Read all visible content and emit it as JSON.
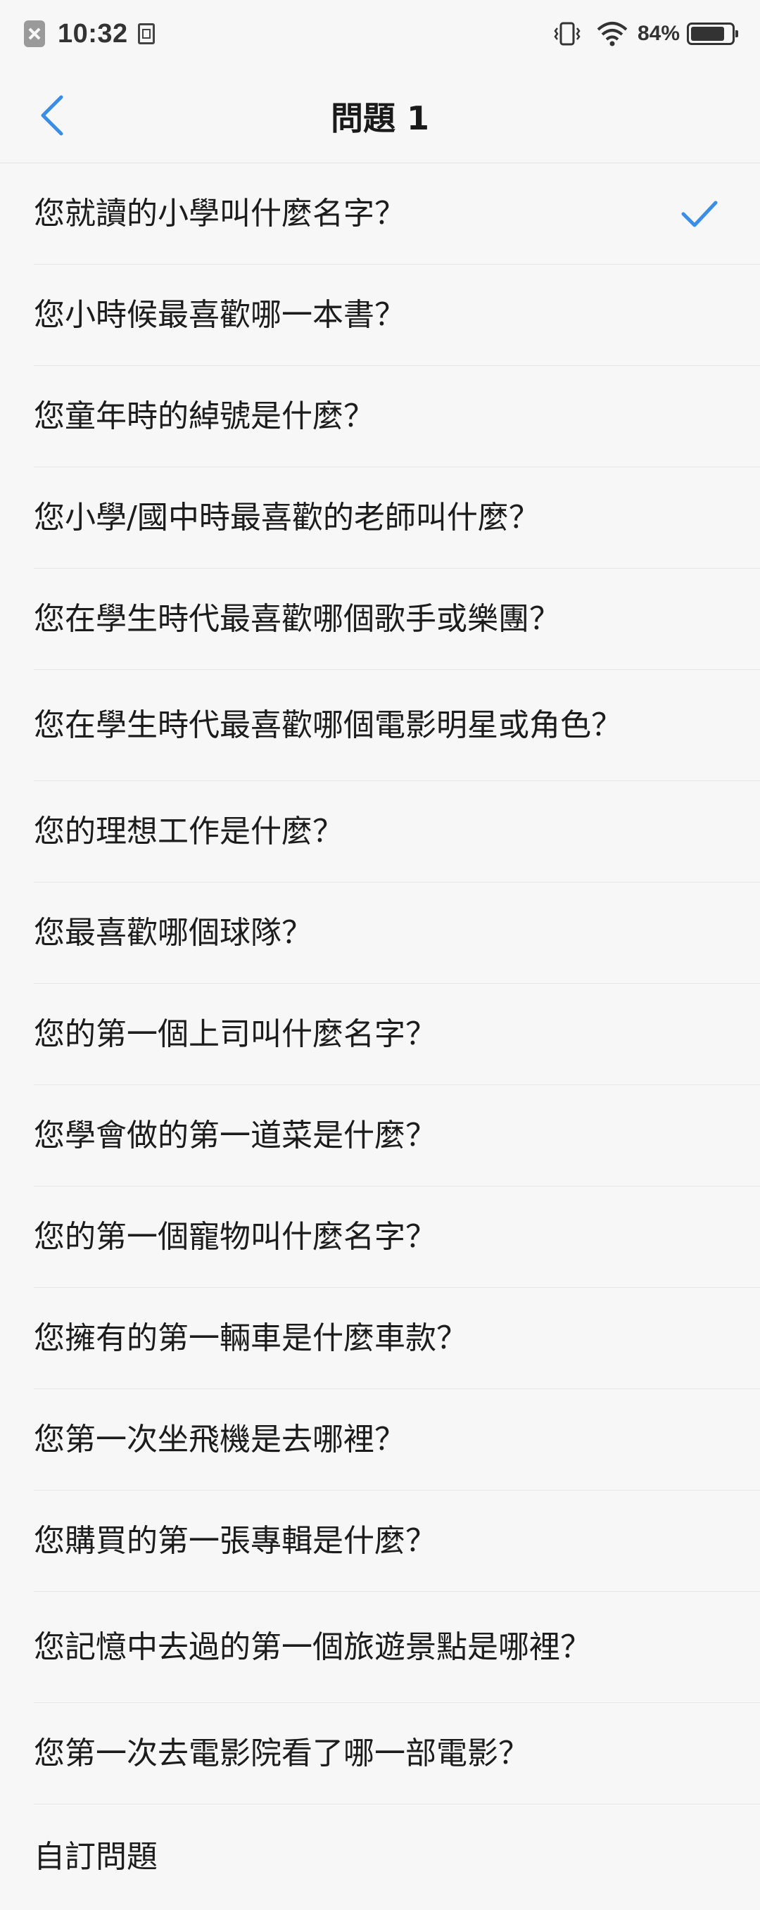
{
  "status_bar": {
    "time": "10:32",
    "battery_percent": "84%",
    "battery_level": 0.84,
    "icons": [
      "notification-icon",
      "sim-icon",
      "vibrate-icon",
      "wifi-icon",
      "battery-icon"
    ]
  },
  "header": {
    "title": "問題 1",
    "back_icon": "chevron-left-icon"
  },
  "colors": {
    "accent": "#3a8ee6",
    "background": "#f7f7f7",
    "divider": "#e6e6e6"
  },
  "questions": {
    "items": [
      {
        "label": "您就讀的小學叫什麼名字？",
        "selected": true
      },
      {
        "label": "您小時候最喜歡哪一本書？",
        "selected": false
      },
      {
        "label": "您童年時的綽號是什麼？",
        "selected": false
      },
      {
        "label": "您小學/國中時最喜歡的老師叫什麼？",
        "selected": false
      },
      {
        "label": "您在學生時代最喜歡哪個歌手或樂團？",
        "selected": false
      },
      {
        "label": "您在學生時代最喜歡哪個電影明星或角色？",
        "selected": false
      },
      {
        "label": "您的理想工作是什麼？",
        "selected": false
      },
      {
        "label": "您最喜歡哪個球隊？",
        "selected": false
      },
      {
        "label": "您的第一個上司叫什麼名字？",
        "selected": false
      },
      {
        "label": "您學會做的第一道菜是什麼？",
        "selected": false
      },
      {
        "label": "您的第一個寵物叫什麼名字？",
        "selected": false
      },
      {
        "label": "您擁有的第一輛車是什麼車款？",
        "selected": false
      },
      {
        "label": "您第一次坐飛機是去哪裡？",
        "selected": false
      },
      {
        "label": "您購買的第一張專輯是什麼？",
        "selected": false
      },
      {
        "label": "您記憶中去過的第一個旅遊景點是哪裡？",
        "selected": false
      },
      {
        "label": "您第一次去電影院看了哪一部電影？",
        "selected": false
      },
      {
        "label": "自訂問題",
        "selected": false
      }
    ]
  }
}
